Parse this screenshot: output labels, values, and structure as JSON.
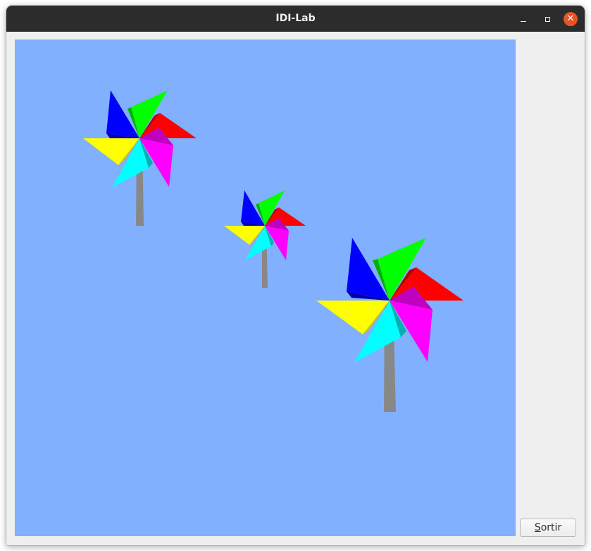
{
  "window": {
    "title": "IDI-Lab",
    "controls": {
      "minimize_icon": "minimize-icon",
      "maximize_icon": "maximize-icon",
      "close_icon": "close-icon",
      "close_glyph": "✕",
      "close_color": "#e95420"
    }
  },
  "scene": {
    "background_color": "#80b0ff",
    "pinwheel_count": 3,
    "blade_colors": [
      "#0000ff",
      "#00ff00",
      "#ff0000",
      "#ff00ff",
      "#00ffff",
      "#ffff00"
    ],
    "stick_color": "#888888"
  },
  "exit_button": {
    "mnemonic": "S",
    "rest": "ortir"
  }
}
